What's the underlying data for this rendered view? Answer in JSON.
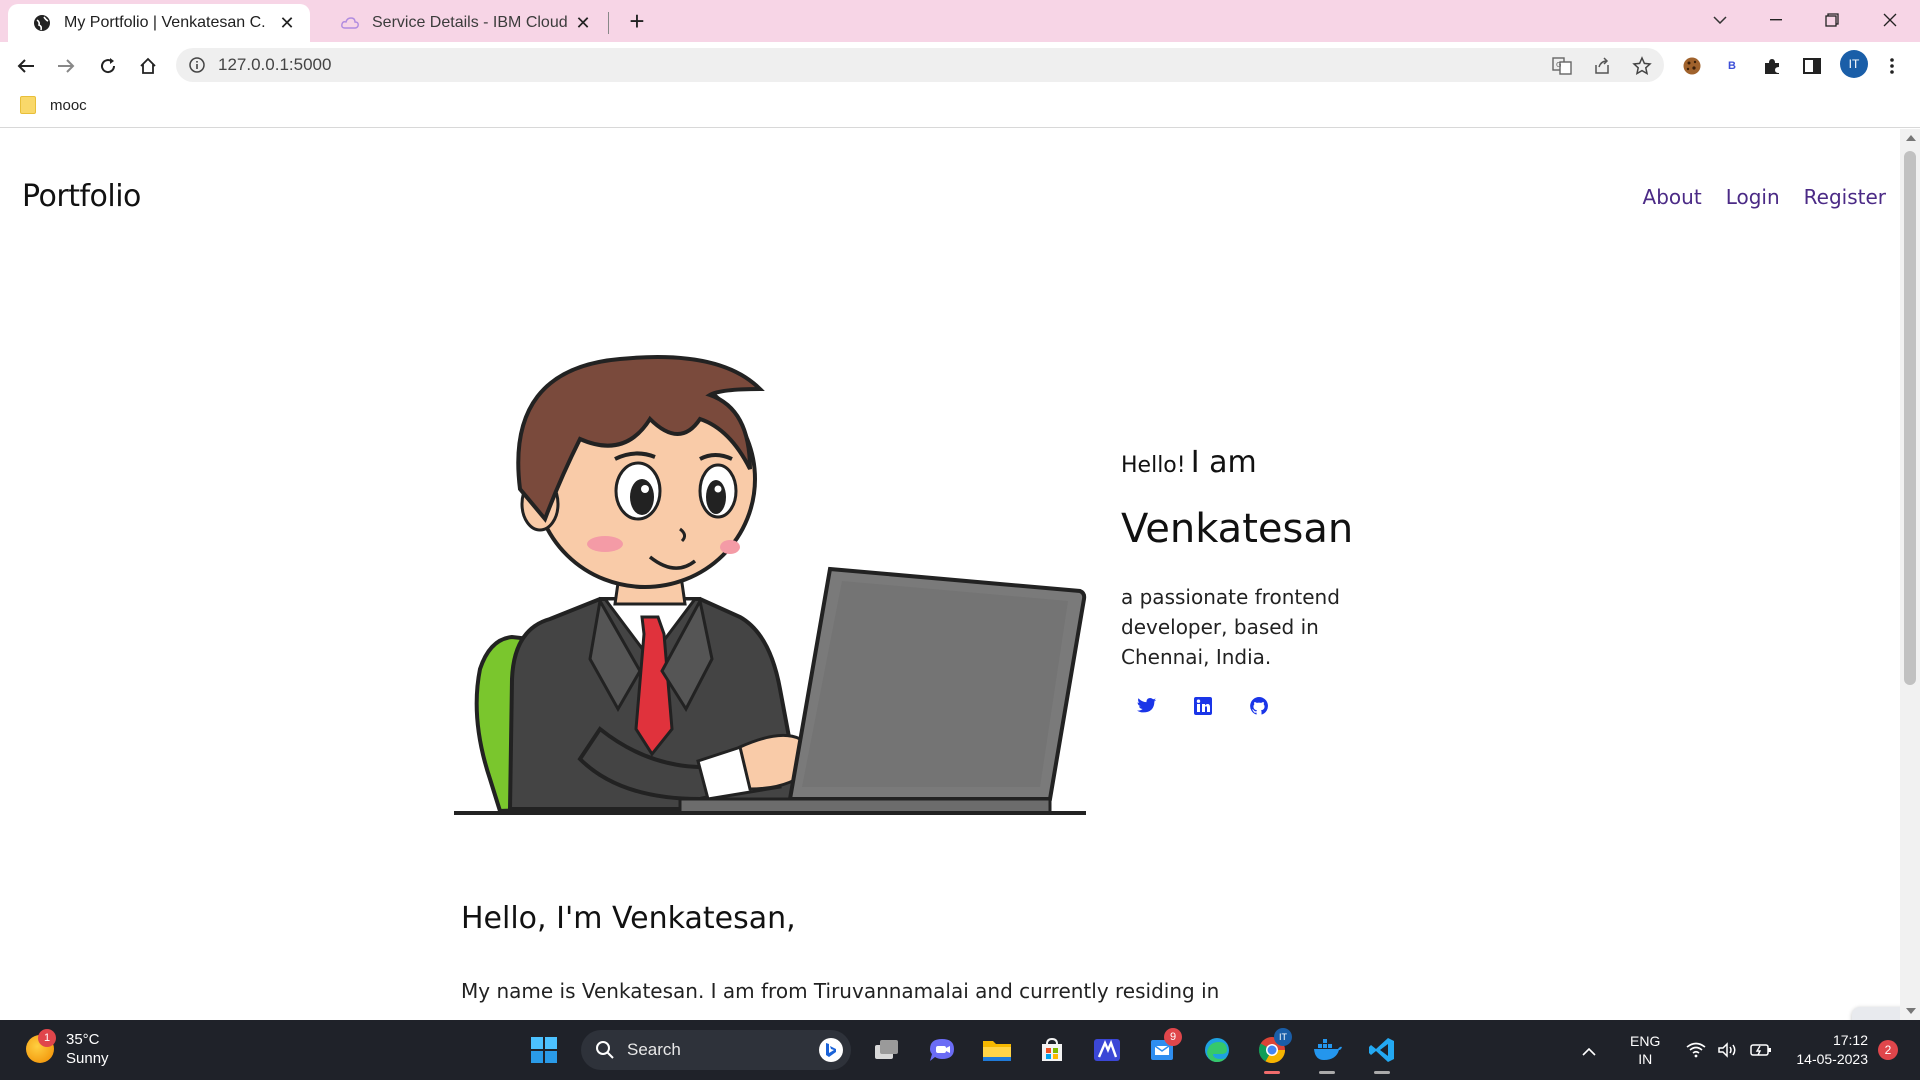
{
  "browser": {
    "tabs": [
      {
        "title": "My Portfolio | Venkatesan C.",
        "active": true
      },
      {
        "title": "Service Details - IBM Cloud",
        "active": false
      }
    ],
    "url": "127.0.0.1:5000",
    "profile_initials": "IT",
    "extension_letter": "B",
    "bookmarks": [
      {
        "label": "mooc"
      }
    ]
  },
  "page": {
    "brand": "Portfolio",
    "nav": [
      {
        "label": "About"
      },
      {
        "label": "Login"
      },
      {
        "label": "Register"
      }
    ],
    "hero": {
      "greeting_small": "Hello!",
      "greeting_big": "I am",
      "name": "Venkatesan",
      "description": "a passionate frontend developer, based in Chennai, India.",
      "socials": [
        "twitter-icon",
        "linkedin-icon",
        "github-icon"
      ]
    },
    "about": {
      "heading": "Hello, I'm Venkatesan,",
      "paragraph": "My name is Venkatesan. I am from Tiruvannamalai and currently residing in"
    }
  },
  "taskbar": {
    "weather": {
      "temp": "35°C",
      "condition": "Sunny",
      "badge": "1"
    },
    "search_label": "Search",
    "app_badge": "9",
    "profile_badge": "IT",
    "language": {
      "line1": "ENG",
      "line2": "IN"
    },
    "time": "17:12",
    "date": "14-05-2023",
    "notifications": "2"
  },
  "colors": {
    "tabbar_bg": "#f7d5e6",
    "nav_link": "#4b2a86",
    "social_icon": "#1a35e8",
    "taskbar_bg": "#1f2229"
  }
}
